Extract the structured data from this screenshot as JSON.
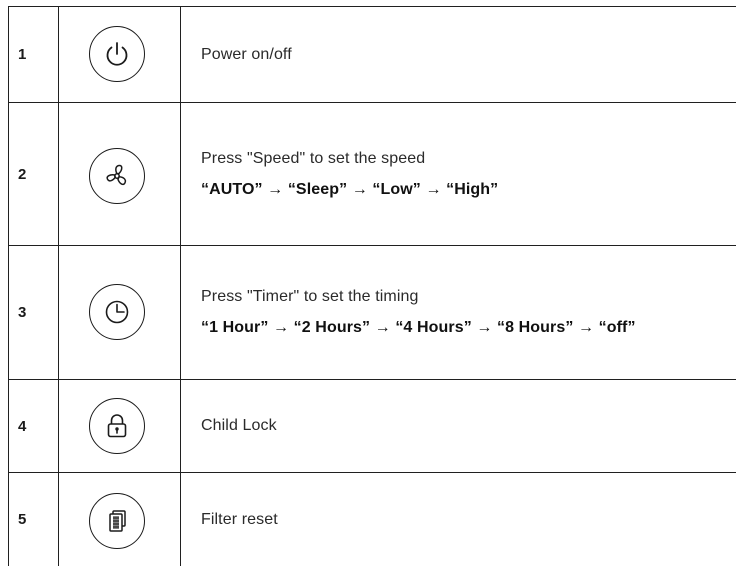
{
  "rows": [
    {
      "number": "1",
      "icon": "power-icon",
      "label": "Power on/off",
      "sequence": ""
    },
    {
      "number": "2",
      "icon": "fan-icon",
      "label": "Press \"Speed\" to set the speed",
      "sequence": "“AUTO” → “Sleep” → “Low” → “High”"
    },
    {
      "number": "3",
      "icon": "clock-icon",
      "label": "Press \"Timer\" to set the timing",
      "sequence": "“1 Hour” → “2 Hours” → “4 Hours” → “8 Hours” → “off”"
    },
    {
      "number": "4",
      "icon": "lock-icon",
      "label": "Child Lock",
      "sequence": ""
    },
    {
      "number": "5",
      "icon": "filter-icon",
      "label": "Filter reset",
      "sequence": ""
    }
  ],
  "colors": {
    "line": "#202020",
    "text": "#1b1b1b"
  }
}
